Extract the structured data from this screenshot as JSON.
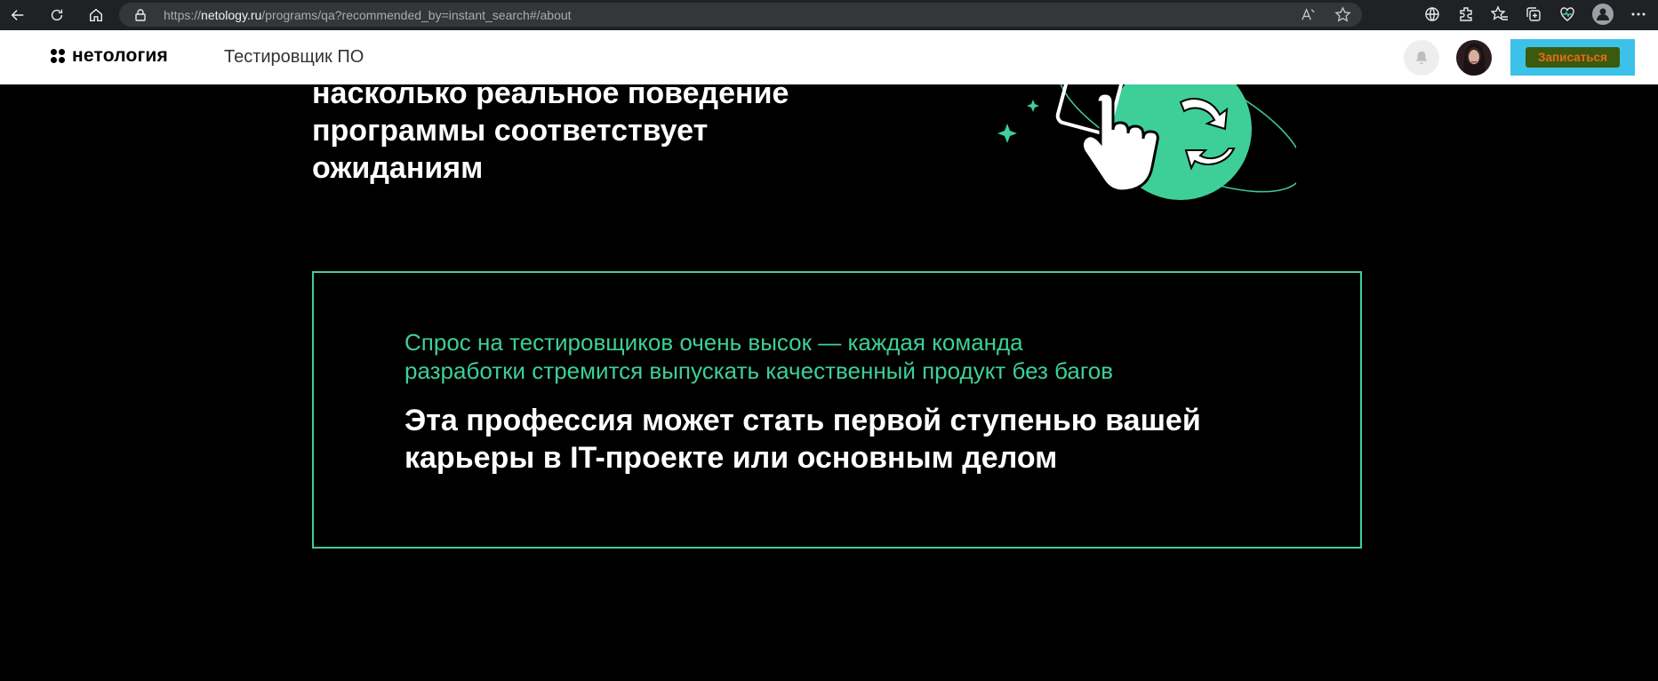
{
  "browser": {
    "url_prefix": "https://",
    "url_host": "netology.ru",
    "url_path": "/programs/qa?recommended_by=instant_search#/about"
  },
  "header": {
    "logo_text": "нетология",
    "course_title": "Тестировщик ПО",
    "enroll_label": "Записаться"
  },
  "hero": {
    "lines": [
      "насколько реальное поведение",
      "программы соответствует",
      "ожиданиям"
    ]
  },
  "callout": {
    "subtitle_lines": [
      "Спрос на тестировщиков очень высок — каждая команда",
      "разработки стремится выпускать качественный продукт без багов"
    ],
    "headline_lines": [
      "Эта профессия может стать первой ступенью вашей",
      "карьеры в IT-проекте или основным делом"
    ]
  },
  "colors": {
    "accent": "#3ecf98",
    "enroll_bg": "#3cc2e8"
  },
  "icons": [
    "back-icon",
    "reload-icon",
    "home-icon",
    "lock-icon",
    "read-aloud-icon",
    "favorite-star-icon",
    "translate-icon",
    "extensions-icon",
    "favorites-icon",
    "collections-icon",
    "health-icon",
    "profile-icon",
    "more-icon",
    "bell-icon"
  ]
}
